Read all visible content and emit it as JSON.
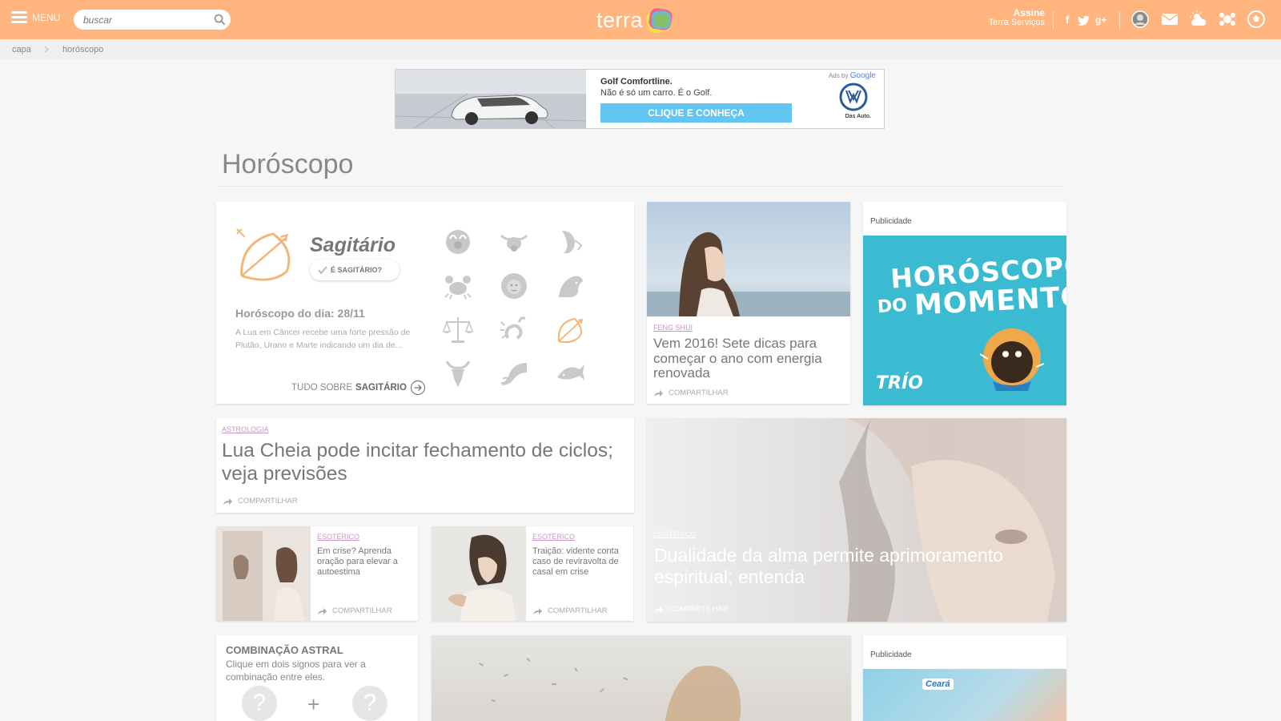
{
  "header": {
    "menu_label": "MENU",
    "search_placeholder": "buscar",
    "logo_text": "terra",
    "assine": "Assine",
    "terra_servicos": "Terra Serviços",
    "social": {
      "facebook": "f",
      "twitter": "t",
      "googleplus": "g+"
    },
    "accent": "#ffb57d"
  },
  "breadcrumb": {
    "items": [
      "capa",
      "horóscopo"
    ]
  },
  "ad_banner": {
    "title": "Golf Comfortline.",
    "subtitle": "Não é só um carro. É o Golf.",
    "cta": "CLIQUE E CONHEÇA",
    "ads_by": "Ads by",
    "google": "Google",
    "brand": "Das Auto."
  },
  "page_title": "Horóscopo",
  "sign_card": {
    "name": "Sagitário",
    "confirm": "É SAGITÁRIO?",
    "daily_label": "Horóscopo do dia: 28/11",
    "text": "A Lua em Câncer recebe uma forte pressão de Plutão, Urano e Marte indicando um dia de...",
    "more_prefix": "TUDO SOBRE",
    "more_sign": "SAGITÁRIO",
    "zodiac_icons": [
      "aries-icon",
      "taurus-icon",
      "gemini-icon",
      "cancer-icon",
      "leo-icon",
      "virgo-icon",
      "libra-icon",
      "scorpio-icon",
      "sagittarius-icon",
      "capricorn-icon",
      "aquarius-icon",
      "pisces-icon"
    ]
  },
  "feng_shui": {
    "tag": "FENG SHUI",
    "title": "Vem 2016! Sete dicas para começar o ano com energia renovada",
    "share": "COMPARTILHAR"
  },
  "ad_box": {
    "label": "Publicidade",
    "line1": "HORÓSCOPO",
    "line2a": "DO",
    "line2b": "MOMENTO",
    "brand": "TRÍO"
  },
  "headline_card": {
    "tag": "ASTROLOGIA",
    "title": "Lua Cheia pode incitar fechamento de ciclos; veja previsões",
    "share": "COMPARTILHAR"
  },
  "feature": {
    "tag": "ESOTÉRICO",
    "title": "Dualidade da alma permite aprimoramento espiritual; entenda",
    "share": "COMPARTILHAR"
  },
  "small_cards": [
    {
      "tag": "ESOTÉRICO",
      "title": "Em crise? Aprenda oração para elevar a autoestima",
      "share": "COMPARTILHAR"
    },
    {
      "tag": "ESOTÉRICO",
      "title": "Traição: vidente conta caso de reviravolta de casal em crise",
      "share": "COMPARTILHAR"
    }
  ],
  "combo": {
    "title": "COMBINAÇÃO ASTRAL",
    "text": "Clique em dois signos para ver a combinação entre eles.",
    "q": "?",
    "plus": "+"
  },
  "ad_box2": {
    "label": "Publicidade",
    "brand": "Ceará"
  }
}
